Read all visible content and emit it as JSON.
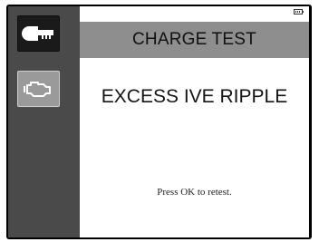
{
  "header": {
    "title": "CHARGE TEST",
    "battery_icon": "battery-level-icon"
  },
  "sidebar": {
    "items": [
      {
        "icon": "battery-tester-icon",
        "selected": true
      },
      {
        "icon": "engine-icon",
        "selected": false
      }
    ]
  },
  "main": {
    "result": "EXCESS IVE RIPPLE",
    "instruction": "Press OK to retest."
  },
  "colors": {
    "sidebar": "#4a4a4a",
    "title_bar": "#8e8e8e",
    "selected_tab": "#1a1a1a",
    "unselected_tab": "#9a9a9a"
  }
}
